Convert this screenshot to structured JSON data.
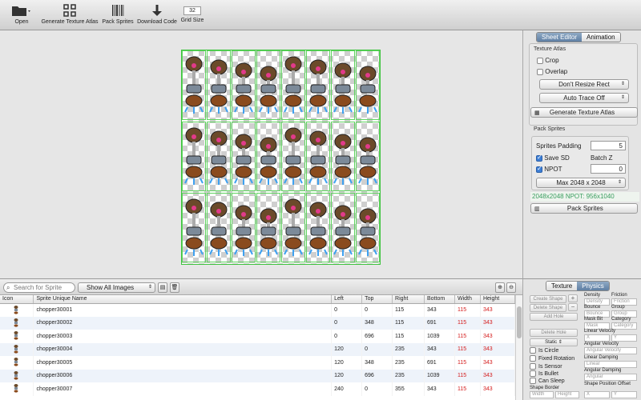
{
  "toolbar": {
    "open": "Open",
    "generate_atlas": "Generate Texture Atlas",
    "pack_sprites": "Pack Sprites",
    "download_code": "Download Code",
    "grid_size_label": "Grid Size",
    "grid_size_value": "32"
  },
  "right_panel": {
    "tab_sheet_editor": "Sheet Editor",
    "tab_animation": "Animation",
    "texture_atlas_label": "Texture Atlas",
    "crop": "Crop",
    "overlap": "Overlap",
    "resize_option": "Don't Resize Rect",
    "trace_option": "Auto Trace Off",
    "generate_button": "Generate Texture Atlas",
    "pack_sprites_label": "Pack Sprites",
    "sprites_padding_label": "Sprites Padding",
    "sprites_padding_value": "5",
    "save_sd": "Save SD",
    "batch_z_label": "Batch Z",
    "npot": "NPOT",
    "batch_z_value": "0",
    "max_size_option": "Max 2048 x 2048",
    "size_info": "2048x2048 NPOT: 956x1040",
    "pack_button": "Pack Sprites"
  },
  "list": {
    "search_placeholder": "Search for Sprite",
    "filter_option": "Show All Images",
    "columns": [
      "Icon",
      "Sprite Unique Name",
      "Left",
      "Top",
      "Right",
      "Bottom",
      "Width",
      "Height"
    ],
    "rows": [
      {
        "name": "chopper30001",
        "left": "0",
        "top": "0",
        "right": "115",
        "bottom": "343",
        "width": "115",
        "height": "343"
      },
      {
        "name": "chopper30002",
        "left": "0",
        "top": "348",
        "right": "115",
        "bottom": "691",
        "width": "115",
        "height": "343"
      },
      {
        "name": "chopper30003",
        "left": "0",
        "top": "696",
        "right": "115",
        "bottom": "1039",
        "width": "115",
        "height": "343"
      },
      {
        "name": "chopper30004",
        "left": "120",
        "top": "0",
        "right": "235",
        "bottom": "343",
        "width": "115",
        "height": "343"
      },
      {
        "name": "chopper30005",
        "left": "120",
        "top": "348",
        "right": "235",
        "bottom": "691",
        "width": "115",
        "height": "343"
      },
      {
        "name": "chopper30006",
        "left": "120",
        "top": "696",
        "right": "235",
        "bottom": "1039",
        "width": "115",
        "height": "343"
      },
      {
        "name": "chopper30007",
        "left": "240",
        "top": "0",
        "right": "355",
        "bottom": "343",
        "width": "115",
        "height": "343"
      }
    ]
  },
  "physics": {
    "tab_texture": "Texture",
    "tab_physics": "Physics",
    "create_shape": "Create Shape",
    "delete_shape": "Delete Shape",
    "add_hole": "Add Hole",
    "delete_hole": "Delete Hole",
    "static_option": "Static",
    "density_label": "Density",
    "density_ph": "Density",
    "friction_label": "Friction",
    "friction_ph": "Friction",
    "bounce_label": "Bounce",
    "bounce_ph": "Bounce",
    "group_label": "Group",
    "group_ph": "Group",
    "mask_bit_label": "Mask Bit",
    "mask_ph": "Mask",
    "category_label": "Category",
    "category_ph": "Category",
    "linear_velocity_label": "Linear Velocity",
    "x_ph": "X",
    "y_ph": "Y",
    "angular_velocity_label": "Angular Velocity",
    "angular_velocity_ph": "Angular Velocity",
    "is_circle": "Is Circle",
    "fixed_rotation": "Fixed Rotation",
    "is_sensor": "Is Sensor",
    "is_bullet": "Is Bullet",
    "can_sleep": "Can Sleep",
    "linear_damping_label": "Linear Damping",
    "linear_ph": "Linear",
    "angular_damping_label": "Angular Damping",
    "angular_ph": "Angular",
    "shape_border_label": "Shape Border",
    "width_ph": "Width",
    "height_ph": "Height",
    "shape_offset_label": "Shape Position Offset"
  },
  "colors": {
    "accent_tab": "#5f7fa3",
    "atlas_border": "#3ec43e",
    "size_info_text": "#3a9e5f",
    "table_red": "#d41b1b"
  }
}
